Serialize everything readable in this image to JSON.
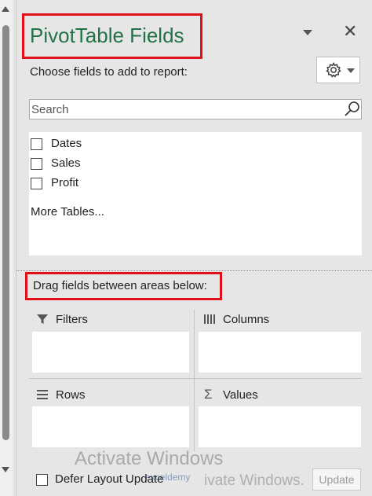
{
  "panel": {
    "title": "PivotTable Fields",
    "accent_color": "#217346",
    "highlight_color": "#e0101a",
    "choose_label": "Choose fields to add to report:",
    "settings_icon": "gear-icon",
    "dropdown_icon": "chevron-down-icon",
    "close_icon": "close-icon",
    "close_glyph": "✕"
  },
  "search": {
    "placeholder": "Search",
    "value": ""
  },
  "fields": [
    {
      "label": "Dates",
      "checked": false
    },
    {
      "label": "Sales",
      "checked": false
    },
    {
      "label": "Profit",
      "checked": false
    }
  ],
  "more_tables": "More Tables...",
  "areas": {
    "drag_label": "Drag fields between areas below:",
    "filters": {
      "label": "Filters",
      "icon": "filter-icon"
    },
    "columns": {
      "label": "Columns",
      "icon": "columns-icon"
    },
    "rows": {
      "label": "Rows",
      "icon": "rows-icon"
    },
    "values": {
      "label": "Values",
      "icon": "sigma-icon",
      "glyph": "Σ"
    }
  },
  "footer": {
    "defer_label": "Defer Layout Update",
    "defer_checked": false,
    "update_label": "Update"
  },
  "watermark": {
    "line1": "Activate Windows",
    "line2": "ivate Windows.",
    "logo": "exceldemy"
  }
}
